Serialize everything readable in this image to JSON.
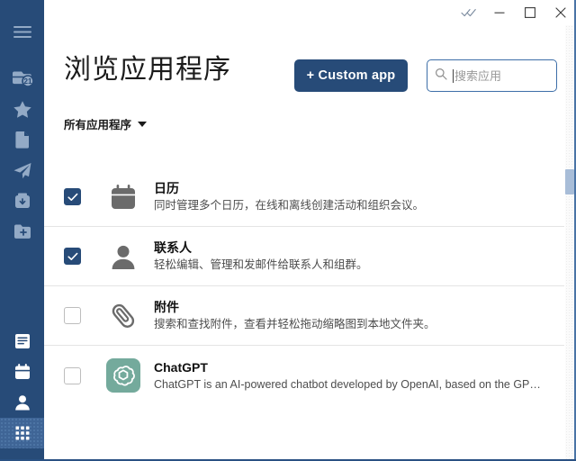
{
  "window": {
    "controls": [
      {
        "name": "double-check-icon",
        "label": "",
        "icon": "double-check"
      },
      {
        "name": "minimize-button",
        "label": "",
        "icon": "minimize"
      },
      {
        "name": "maximize-button",
        "label": "",
        "icon": "maximize"
      },
      {
        "name": "close-button",
        "label": "",
        "icon": "close"
      }
    ]
  },
  "sidebar": {
    "background_color": "#274b78",
    "icon_color": "#93aac6",
    "active_color": "#3f6596",
    "top_items": [
      {
        "name": "hamburger-menu-icon",
        "icon": "hamburger",
        "badge": ""
      },
      {
        "name": "mail-inbox-icon",
        "icon": "mail",
        "badge": "21"
      },
      {
        "name": "favorites-star-icon",
        "icon": "star",
        "badge": ""
      },
      {
        "name": "drafts-document-icon",
        "icon": "document",
        "badge": ""
      },
      {
        "name": "sent-paper-plane-icon",
        "icon": "send",
        "badge": ""
      },
      {
        "name": "archive-box-icon",
        "icon": "archive",
        "badge": ""
      },
      {
        "name": "new-folder-icon",
        "icon": "folder-plus",
        "badge": ""
      }
    ],
    "bottom_items": [
      {
        "name": "notes-icon",
        "icon": "notes",
        "active": false
      },
      {
        "name": "calendar-icon",
        "icon": "calendar",
        "active": false
      },
      {
        "name": "contacts-person-icon",
        "icon": "person",
        "active": false
      },
      {
        "name": "apps-grid-icon",
        "icon": "apps-grid",
        "active": true
      }
    ]
  },
  "header": {
    "title": "浏览应用程序",
    "custom_app_label": "+ Custom app",
    "custom_app_color": "#274b78"
  },
  "search": {
    "value": "",
    "placeholder": "搜索应用",
    "focus_border_color": "#3d6ea8"
  },
  "filter": {
    "label": "所有应用程序"
  },
  "apps": [
    {
      "name": "日历",
      "description": "同时管理多个日历，在线和离线创建活动和组织会议。",
      "checked": true,
      "icon": "calendar",
      "icon_color": "#6b6b6b"
    },
    {
      "name": "联系人",
      "description": "轻松编辑、管理和发邮件给联系人和组群。",
      "checked": true,
      "icon": "person",
      "icon_color": "#6b6b6b"
    },
    {
      "name": "附件",
      "description": "搜索和查找附件，查看并轻松拖动缩略图到本地文件夹。",
      "checked": false,
      "icon": "paperclip",
      "icon_color": "#6b6b6b"
    },
    {
      "name": "ChatGPT",
      "description": "ChatGPT is an AI-powered chatbot developed by OpenAI, based on the GP…",
      "checked": false,
      "icon": "chatgpt",
      "icon_color": "#74aa9c"
    }
  ],
  "scrollbar": {
    "thumb_color": "#a8bdd8"
  }
}
